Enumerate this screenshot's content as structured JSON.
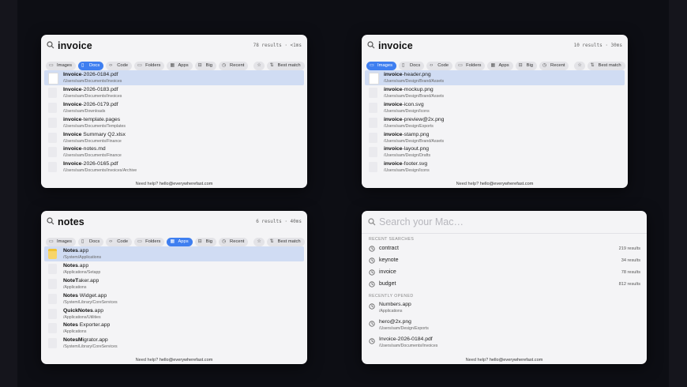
{
  "panels": [
    {
      "query": "invoice",
      "meta": "78 results · <1ms",
      "filters": [
        {
          "label": "Images",
          "icon": "image-icon",
          "active": false
        },
        {
          "label": "Docs",
          "icon": "doc-icon",
          "active": true
        },
        {
          "label": "Code",
          "icon": "code-icon",
          "active": false
        },
        {
          "label": "Folders",
          "icon": "folder-icon",
          "active": false
        },
        {
          "label": "Apps",
          "icon": "apps-icon",
          "active": false
        },
        {
          "label": "Big",
          "icon": "big-icon",
          "active": false
        },
        {
          "label": "Recent",
          "icon": "clock-icon",
          "active": false
        }
      ],
      "sort_label": "Best match",
      "items": [
        {
          "bold": "Invoice",
          "rest": "-2026-0184.pdf",
          "path": "/Users/sam/Documents/Invoices",
          "selected": true,
          "icon": "pdf-file-icon"
        },
        {
          "bold": "Invoice",
          "rest": "-2026-0183.pdf",
          "path": "/Users/sam/Documents/Invoices",
          "selected": false,
          "icon": "pdf-file-icon"
        },
        {
          "bold": "Invoice",
          "rest": "-2026-0179.pdf",
          "path": "/Users/sam/Downloads",
          "selected": false,
          "icon": "pdf-file-icon"
        },
        {
          "bold": "invoice",
          "rest": "-template.pages",
          "path": "/Users/sam/Documents/Templates",
          "selected": false,
          "icon": "pages-file-icon"
        },
        {
          "bold": "Invoice",
          "rest": " Summary Q2.xlsx",
          "path": "/Users/sam/Documents/Finance",
          "selected": false,
          "icon": "xlsx-file-icon"
        },
        {
          "bold": "invoice",
          "rest": "-notes.md",
          "path": "/Users/sam/Documents/Finance",
          "selected": false,
          "icon": "md-file-icon"
        },
        {
          "bold": "Invoice",
          "rest": "-2026-0165.pdf",
          "path": "/Users/sam/Documents/Invoices/Archive",
          "selected": false,
          "icon": "pdf-file-icon"
        }
      ]
    },
    {
      "query": "invoice",
      "meta": "10 results · 30ms",
      "filters": [
        {
          "label": "Images",
          "icon": "image-icon",
          "active": true
        },
        {
          "label": "Docs",
          "icon": "doc-icon",
          "active": false
        },
        {
          "label": "Code",
          "icon": "code-icon",
          "active": false
        },
        {
          "label": "Folders",
          "icon": "folder-icon",
          "active": false
        },
        {
          "label": "Apps",
          "icon": "apps-icon",
          "active": false
        },
        {
          "label": "Big",
          "icon": "big-icon",
          "active": false
        },
        {
          "label": "Recent",
          "icon": "clock-icon",
          "active": false
        }
      ],
      "sort_label": "Best match",
      "items": [
        {
          "bold": "invoice",
          "rest": "-header.png",
          "path": "/Users/sam/Design/Brand/Assets",
          "selected": true,
          "icon": "image-file-icon"
        },
        {
          "bold": "invoice",
          "rest": "-mockup.png",
          "path": "/Users/sam/Design/Brand/Assets",
          "selected": false,
          "icon": "image-file-icon"
        },
        {
          "bold": "invoice",
          "rest": "-icon.svg",
          "path": "/Users/sam/Design/Icons",
          "selected": false,
          "icon": "image-file-icon"
        },
        {
          "bold": "invoice",
          "rest": "-preview@2x.png",
          "path": "/Users/sam/Design/Exports",
          "selected": false,
          "icon": "image-file-icon"
        },
        {
          "bold": "invoice",
          "rest": "-stamp.png",
          "path": "/Users/sam/Design/Brand/Assets",
          "selected": false,
          "icon": "image-file-icon"
        },
        {
          "bold": "invoice",
          "rest": "-layout.png",
          "path": "/Users/sam/Design/Drafts",
          "selected": false,
          "icon": "image-file-icon"
        },
        {
          "bold": "invoice",
          "rest": "-footer.svg",
          "path": "/Users/sam/Design/Icons",
          "selected": false,
          "icon": "image-file-icon"
        }
      ]
    },
    {
      "query": "notes",
      "meta": "6 results · 40ms",
      "filters": [
        {
          "label": "Images",
          "icon": "image-icon",
          "active": false
        },
        {
          "label": "Docs",
          "icon": "doc-icon",
          "active": false
        },
        {
          "label": "Code",
          "icon": "code-icon",
          "active": false
        },
        {
          "label": "Folders",
          "icon": "folder-icon",
          "active": false
        },
        {
          "label": "Apps",
          "icon": "apps-icon",
          "active": true
        },
        {
          "label": "Big",
          "icon": "big-icon",
          "active": false
        },
        {
          "label": "Recent",
          "icon": "clock-icon",
          "active": false
        }
      ],
      "sort_label": "Best match",
      "items": [
        {
          "bold": "Notes",
          "rest": ".app",
          "path": "/System/Applications",
          "selected": true,
          "icon": "notes-app-icon"
        },
        {
          "bold": "Notes",
          "rest": ".app",
          "path": "/Applications/Setapp",
          "selected": false,
          "icon": "app-icon"
        },
        {
          "bold": "NoteT",
          "rest": "aker.app",
          "path": "/Applications",
          "selected": false,
          "icon": "app-icon"
        },
        {
          "bold": "Notes",
          "rest": " Widget.app",
          "path": "/System/Library/CoreServices",
          "selected": false,
          "icon": "app-icon"
        },
        {
          "bold": "QuickNotes",
          "rest": ".app",
          "path": "/Applications/Utilities",
          "selected": false,
          "icon": "app-icon"
        },
        {
          "bold": "Notes",
          "rest": " Exporter.app",
          "path": "/Applications",
          "selected": false,
          "icon": "app-icon"
        },
        {
          "bold": "NotesM",
          "rest": "igrator.app",
          "path": "/System/Library/CoreServices",
          "selected": false,
          "icon": "app-icon"
        }
      ]
    }
  ],
  "footer": {
    "prefix": "Need help?",
    "email": "hello@everywherefast.com"
  },
  "empty_panel": {
    "placeholder": "Search your Mac…",
    "recent_searches_label": "RECENT SEARCHES",
    "recent_searches": [
      {
        "term": "contract",
        "count": "219 results"
      },
      {
        "term": "keynote",
        "count": "34 results"
      },
      {
        "term": "invoice",
        "count": "78 results"
      },
      {
        "term": "budget",
        "count": "812 results"
      }
    ],
    "recently_opened_label": "RECENTLY OPENED",
    "recently_opened": [
      {
        "name": "Numbers.app",
        "path": "/Applications"
      },
      {
        "name": "hero@2x.png",
        "path": "/Users/sam/Design/Exports"
      },
      {
        "name": "Invoice-2026-0184.pdf",
        "path": "/Users/sam/Documents/Invoices"
      }
    ]
  },
  "colors": {
    "accent": "#3f7ff0",
    "selection": "#d0dcf3",
    "panel": "#f4f4f6",
    "background": "#0d0e14"
  }
}
